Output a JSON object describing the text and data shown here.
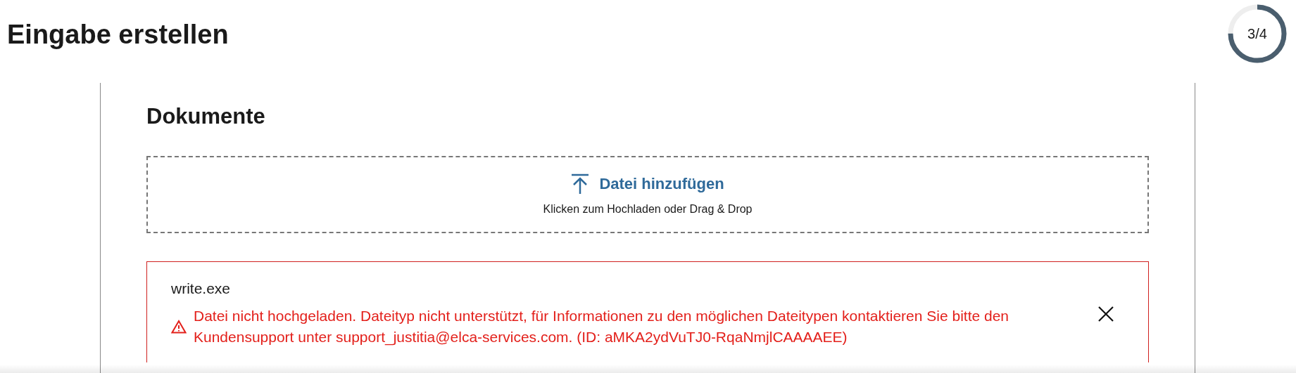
{
  "title": "Eingabe erstellen",
  "progress": {
    "label": "3/4"
  },
  "section": {
    "title": "Dokumente",
    "dropzone": {
      "action": "Datei hinzufügen",
      "hint": "Klicken zum Hochladen oder Drag & Drop"
    },
    "files": [
      {
        "name": "write.exe",
        "kind": "error",
        "message": "Datei nicht hochgeladen. Dateityp nicht unterstützt, für Informationen zu den möglichen Dateitypen kontaktieren Sie bitte den Kundensupport unter support_justitia@elca-services.com. (ID: aMKA2ydVuTJ0-RqaNmjlCAAAAEE)"
      }
    ]
  }
}
